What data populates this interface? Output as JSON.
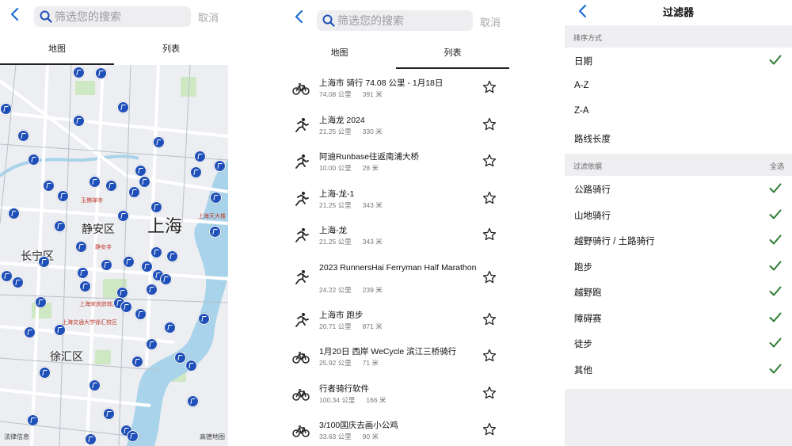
{
  "search": {
    "placeholder": "筛选您的搜索",
    "cancel": "取消"
  },
  "tabs": {
    "map": "地图",
    "list": "列表"
  },
  "map": {
    "districts": [
      "静安区",
      "长宁区",
      "徐汇区"
    ],
    "city": "上海",
    "pois": [
      "静安寺",
      "玉佛禅寺",
      "上海宋庆龄故居",
      "上海交通大学徐汇校区",
      "上海天大楼"
    ],
    "credit_left": "法律信息",
    "credit_right": "高德地图"
  },
  "list": [
    {
      "icon": "bike-icon",
      "title": "上海市 骑行 74.08 公里 - 1月18日",
      "distance": "74.08 公里",
      "elevation": "391 米"
    },
    {
      "icon": "run-icon",
      "title": "上海龙 2024",
      "distance": "21.25 公里",
      "elevation": "330 米"
    },
    {
      "icon": "run-icon",
      "title": "阿迪Runbase往返南浦大桥",
      "distance": "10.00 公里",
      "elevation": "28 米"
    },
    {
      "icon": "run-icon",
      "title": "上海-龙-1",
      "distance": "21.25 公里",
      "elevation": "343 米"
    },
    {
      "icon": "run-icon",
      "title": "上海-龙",
      "distance": "21.25 公里",
      "elevation": "343 米"
    },
    {
      "icon": "run-icon",
      "title": "2023 RunnersHai Ferryman Half Marathon",
      "distance": "24.22 公里",
      "elevation": "239 米"
    },
    {
      "icon": "run-icon",
      "title": "上海市 跑步",
      "distance": "20.71 公里",
      "elevation": "871 米"
    },
    {
      "icon": "bike-icon",
      "title": "1月20日 西岸 WeCycle 滨江三桥骑行",
      "distance": "25.92 公里",
      "elevation": "71 米"
    },
    {
      "icon": "bike-icon",
      "title": "行者骑行软件",
      "distance": "100.34 公里",
      "elevation": "166 米"
    },
    {
      "icon": "bike-icon",
      "title": "3/100国庆去画小公鸡",
      "distance": "33.63 公里",
      "elevation": "90 米"
    }
  ],
  "filter": {
    "title": "过滤器",
    "sort_header": "排序方式",
    "sort_options": [
      "日期",
      "A-Z",
      "Z-A",
      "路线长度"
    ],
    "sort_selected": 0,
    "filter_header": "过滤依据",
    "select_all": "全选",
    "filter_options": [
      "公路骑行",
      "山地骑行",
      "越野骑行 / 土路骑行",
      "跑步",
      "越野跑",
      "障碍赛",
      "徒步",
      "其他"
    ]
  },
  "colors": {
    "accent": "#1f6fd1",
    "pin": "#1f4fb8",
    "check": "#2e7d32"
  }
}
